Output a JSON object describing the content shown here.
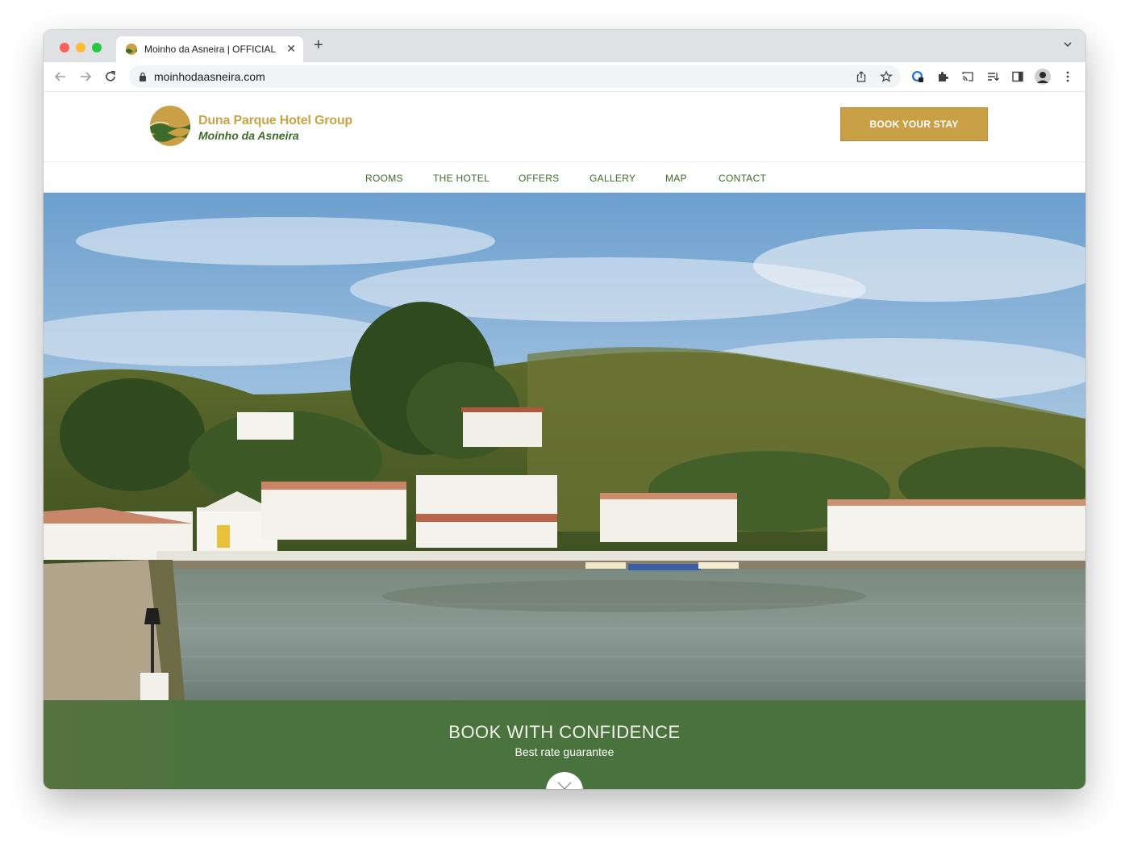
{
  "browser": {
    "tab_title": "Moinho da Asneira | OFFICIAL SITE",
    "new_tab_symbol": "+",
    "close_symbol": "✕",
    "url": "moinhodaasneira.com"
  },
  "site": {
    "brand_name": "Duna Parque Hotel Group",
    "brand_sub": "Moinho da Asneira",
    "book_button": "BOOK YOUR STAY",
    "nav": [
      {
        "label": "ROOMS"
      },
      {
        "label": "THE HOTEL"
      },
      {
        "label": "OFFERS"
      },
      {
        "label": "GALLERY"
      },
      {
        "label": "MAP"
      },
      {
        "label": "CONTACT"
      }
    ],
    "banner_title": "BOOK WITH CONFIDENCE",
    "banner_subtitle": "Best rate guarantee"
  },
  "colors": {
    "gold": "#c9a046",
    "green": "#3c6b2a",
    "banner_green": "#4a723c"
  }
}
